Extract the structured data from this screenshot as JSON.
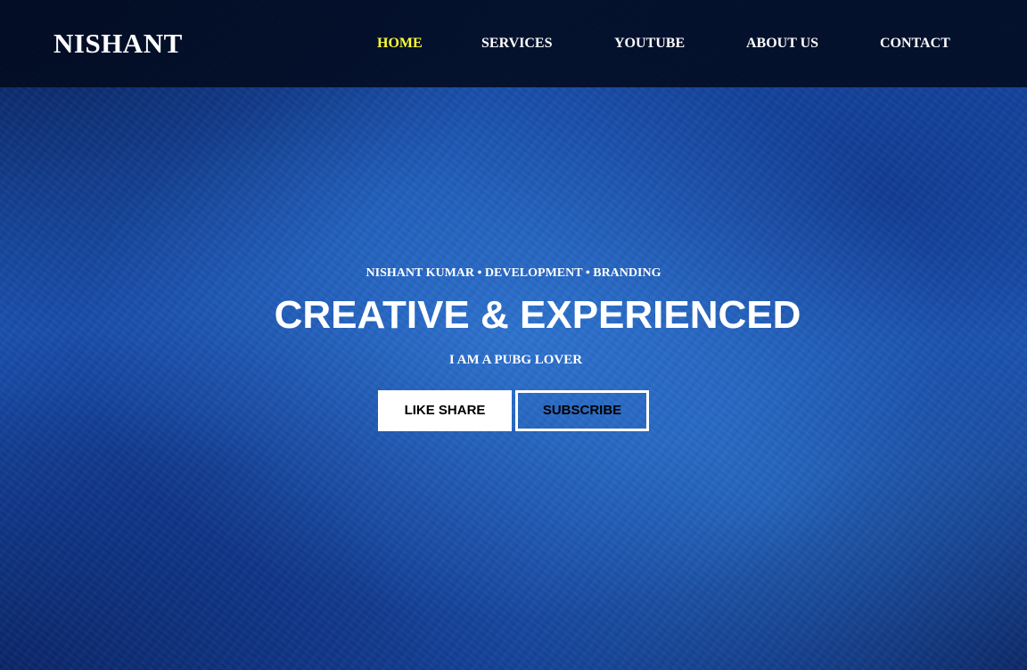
{
  "brand": {
    "name": "NISHANT"
  },
  "nav": {
    "items": [
      {
        "label": "HOME",
        "active": true
      },
      {
        "label": "SERVICES",
        "active": false
      },
      {
        "label": "YOUTUBE",
        "active": false
      },
      {
        "label": "ABOUT US",
        "active": false
      },
      {
        "label": "CONTACT",
        "active": false
      }
    ]
  },
  "hero": {
    "tagline": "NISHANT KUMAR • DEVELOPMENT • BRANDING",
    "headline": "CREATIVE & EXPERIENCED",
    "subline": "I AM A PUBG LOVER",
    "buttons": {
      "primary_label": "LIKE SHARE",
      "secondary_label": "SUBSCRIBE"
    }
  },
  "colors": {
    "background": "#1a4fa8",
    "navbar": "#020a1e",
    "active_link": "#ffff33",
    "text": "#ffffff"
  }
}
